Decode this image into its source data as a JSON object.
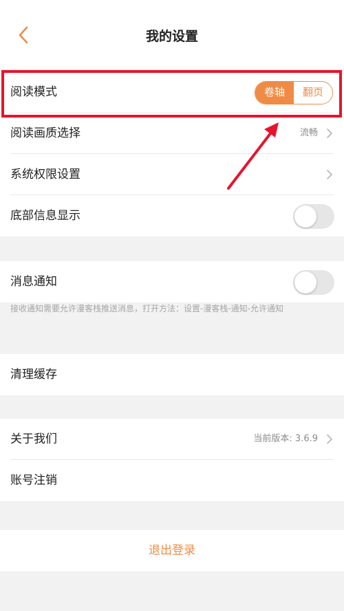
{
  "header": {
    "title": "我的设置",
    "back_icon": "chevron-left-icon"
  },
  "group1": {
    "reading_mode": {
      "label": "阅读模式",
      "options": [
        "卷轴",
        "翻页"
      ],
      "selected": "卷轴"
    },
    "quality": {
      "label": "阅读画质选择",
      "value": "流畅"
    },
    "permissions": {
      "label": "系统权限设置"
    },
    "bottom_info": {
      "label": "底部信息显示",
      "enabled": false
    }
  },
  "group2": {
    "notification": {
      "label": "消息通知",
      "enabled": false
    },
    "hint": "接收通知需要允许漫客栈推送消息，打开方法：设置-漫客栈-通知-允许通知"
  },
  "group3": {
    "clear_cache": {
      "label": "清理缓存"
    }
  },
  "group4": {
    "about": {
      "label": "关于我们",
      "value": "当前版本: 3.6.9"
    },
    "deactivate": {
      "label": "账号注销"
    }
  },
  "logout": {
    "label": "退出登录"
  },
  "colors": {
    "accent": "#ef8b45",
    "annotation": "#e8132c",
    "background": "#f2f2f2"
  }
}
